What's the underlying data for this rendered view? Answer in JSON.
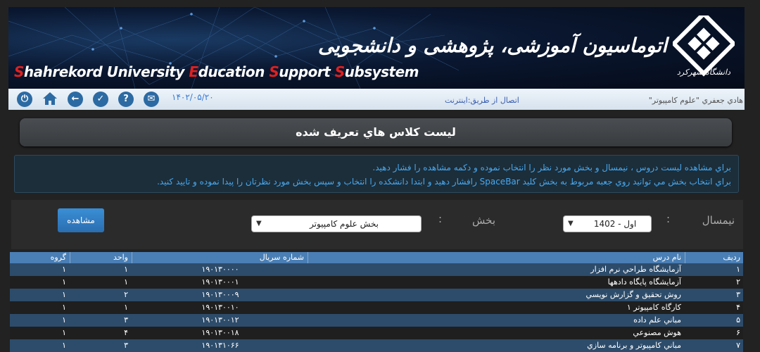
{
  "header": {
    "title_en_parts": [
      {
        "t": "S",
        "hl": true
      },
      {
        "t": "hahrekord University ",
        "hl": false
      },
      {
        "t": "E",
        "hl": true
      },
      {
        "t": "ducation ",
        "hl": false
      },
      {
        "t": "S",
        "hl": true
      },
      {
        "t": "upport ",
        "hl": false
      },
      {
        "t": "S",
        "hl": true
      },
      {
        "t": "ubsystem",
        "hl": false
      }
    ],
    "title_fa": "اتوماسیون آموزشی، پژوهشی و دانشجویی",
    "logo_text": "دانشگاه شهرکرد"
  },
  "toolbar": {
    "icons": [
      "power-icon",
      "home-icon",
      "back-icon",
      "check-icon",
      "help-icon",
      "mail-icon"
    ],
    "date": "۱۴۰۲/۰۵/۲۰",
    "connection": "اتصال از طریق:اینترنت",
    "user": "هادي جعفري \"علوم كامپيوتر\""
  },
  "page_title": "ليست كلاس هاي تعريف شده",
  "info": {
    "line1": "براي مشاهده ليست دروس ، نيمسال و بخش مورد نظر را انتخاب نموده و دكمه مشاهده را فشار دهيد.",
    "line2": "براي انتخاب بخش مي توانيد روي جعبه مربوط به بخش كليد SpaceBar رافشار دهيد و ابتدا دانشكده را انتخاب و سپس بخش مورد نظرتان را پيدا نموده و تاييد كنيد."
  },
  "form": {
    "semester_label": "نيمسال",
    "semester_value": "اول - 1402",
    "department_label": "بخش",
    "department_value": "بخش علوم كامپيوتر",
    "colon": ":",
    "view_button": "مشاهده"
  },
  "table": {
    "headers": {
      "radif": "رديف",
      "name": "نام درس",
      "serial": "شماره سريال",
      "unit": "واحد",
      "group": "گروه"
    },
    "rows": [
      {
        "radif": "۱",
        "name": "آزمايشگاه طراحي نرم افزار",
        "serial": "۱۹۰۱۳۰۰۰۰",
        "unit": "۱",
        "group": "۱"
      },
      {
        "radif": "۲",
        "name": "آزمايشگاه پايگاه دادهها",
        "serial": "۱۹۰۱۳۰۰۰۱",
        "unit": "۱",
        "group": "۱"
      },
      {
        "radif": "۳",
        "name": "روش تحقيق و گزارش نويسي",
        "serial": "۱۹۰۱۳۰۰۰۹",
        "unit": "۲",
        "group": "۱"
      },
      {
        "radif": "۴",
        "name": "كارگاه كامپيوتر ۱",
        "serial": "۱۹۰۱۳۰۰۱۰",
        "unit": "۱",
        "group": "۱"
      },
      {
        "radif": "۵",
        "name": "مباني علم داده",
        "serial": "۱۹۰۱۳۰۰۱۲",
        "unit": "۳",
        "group": "۱"
      },
      {
        "radif": "۶",
        "name": "هوش مصنوعي",
        "serial": "۱۹۰۱۳۰۰۱۸",
        "unit": "۴",
        "group": "۱"
      },
      {
        "radif": "۷",
        "name": "مباني كامپيوتر و برنامه سازي",
        "serial": "۱۹۰۱۳۱۰۶۶",
        "unit": "۳",
        "group": "۱"
      }
    ]
  },
  "colors": {
    "accent": "#4a7fb5",
    "row_alt": "#2d4c6b",
    "info_text": "#47a8f0",
    "highlight_red": "#e02020"
  }
}
